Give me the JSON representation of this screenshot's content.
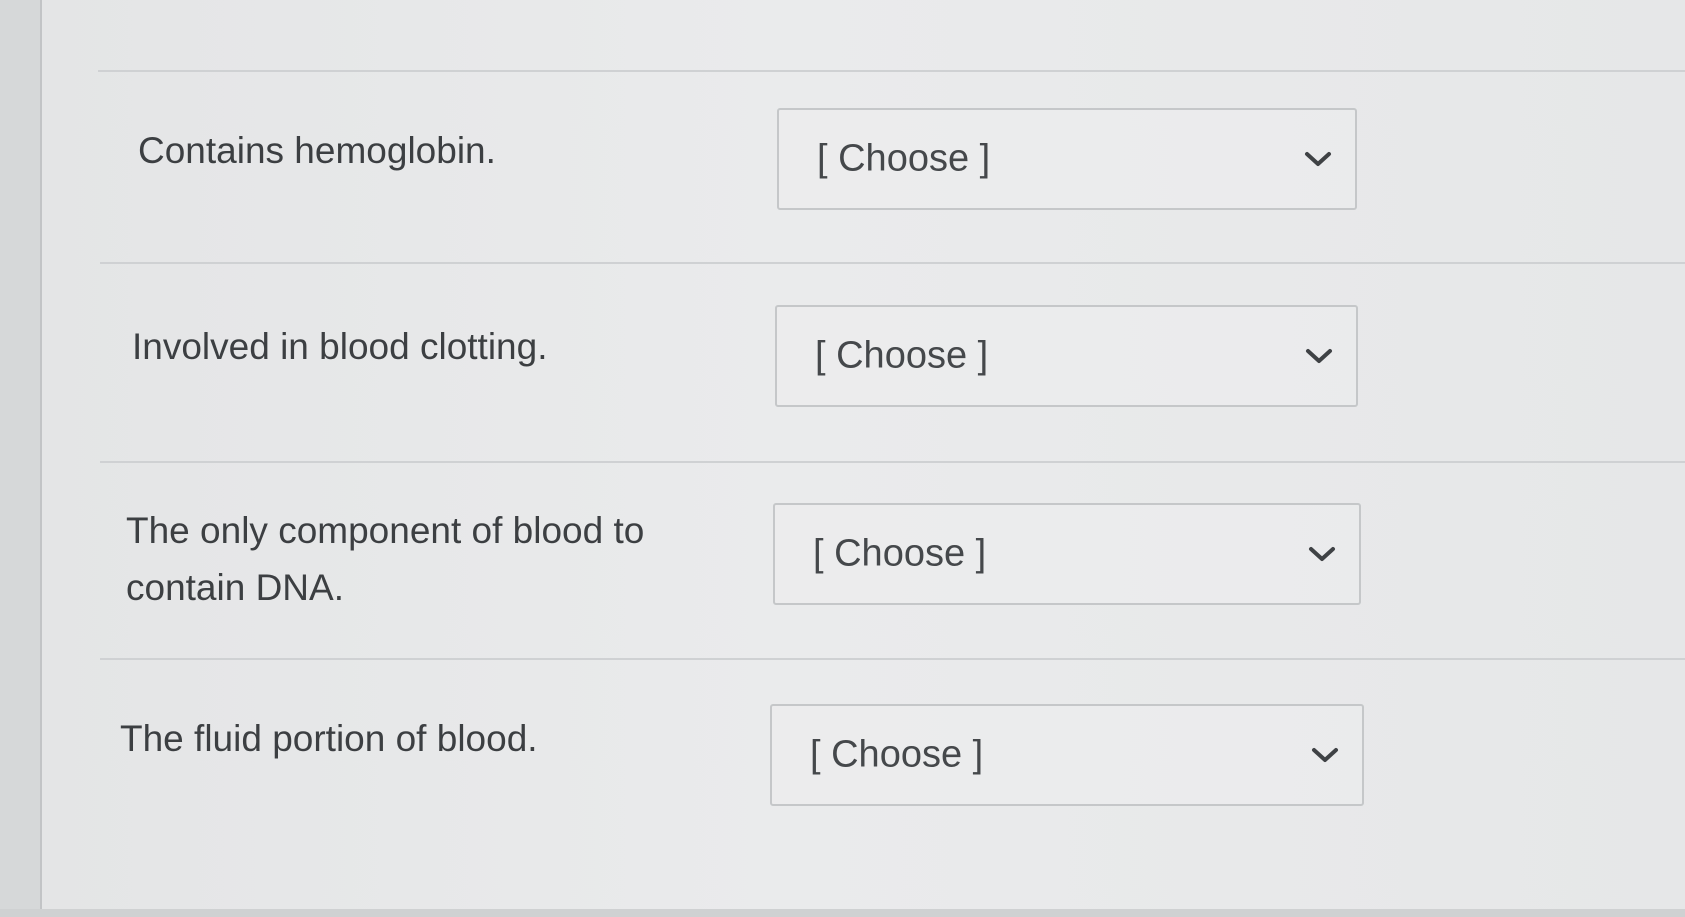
{
  "questions": [
    {
      "prompt": "Contains hemoglobin.",
      "selected": "[ Choose ]"
    },
    {
      "prompt": "Involved in blood clotting.",
      "selected": "[ Choose ]"
    },
    {
      "prompt": "The only component of blood to contain DNA.",
      "selected": "[ Choose ]"
    },
    {
      "prompt": "The fluid portion of blood.",
      "selected": "[ Choose ]"
    }
  ],
  "icons": {
    "dropdown": "chevron-down-icon"
  },
  "colors": {
    "background": "#e6e7e8",
    "text": "#3c3f42",
    "border": "#c5c7c9"
  }
}
